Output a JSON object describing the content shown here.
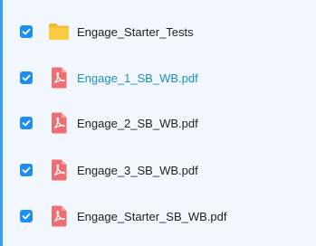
{
  "colors": {
    "accent": "#3c9bf4",
    "checkbox": "#1f8ef1",
    "folder": "#f7c13b",
    "pdf": "#ee6e72",
    "highlight_text": "#1a8fc4"
  },
  "files": [
    {
      "name": "Engage_Starter_Tests",
      "icon": "folder-icon",
      "checked": true,
      "highlighted": false
    },
    {
      "name": "Engage_1_SB_WB.pdf",
      "icon": "pdf-icon",
      "checked": true,
      "highlighted": true
    },
    {
      "name": "Engage_2_SB_WB.pdf",
      "icon": "pdf-icon",
      "checked": true,
      "highlighted": false
    },
    {
      "name": "Engage_3_SB_WB.pdf",
      "icon": "pdf-icon",
      "checked": true,
      "highlighted": false
    },
    {
      "name": "Engage_Starter_SB_WB.pdf",
      "icon": "pdf-icon",
      "checked": true,
      "highlighted": false
    }
  ]
}
